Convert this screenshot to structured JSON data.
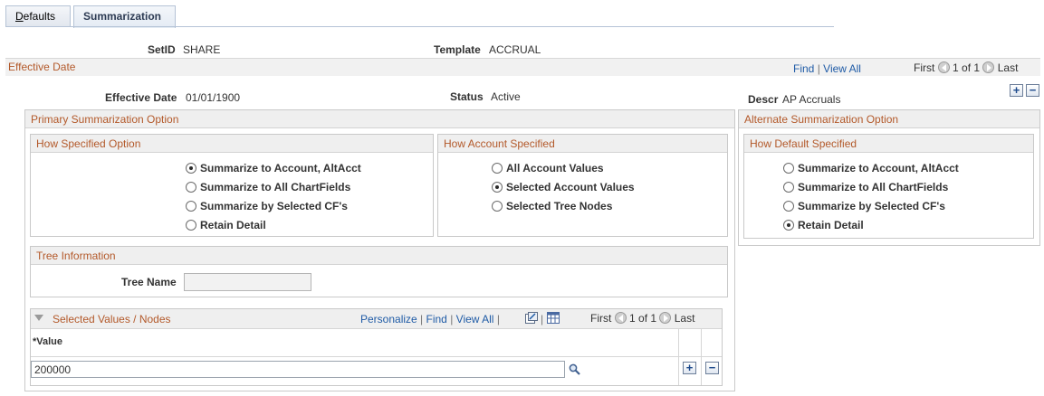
{
  "tabs": [
    {
      "label": "Defaults",
      "underline": "D",
      "rest": "efaults"
    },
    {
      "label": "Summarization"
    }
  ],
  "header": {
    "setid_label": "SetID",
    "setid_value": "SHARE",
    "template_label": "Template",
    "template_value": "ACCRUAL"
  },
  "effective_date": {
    "title": "Effective Date",
    "find": "Find",
    "view_all": "View All",
    "first": "First",
    "pager": "1 of 1",
    "last": "Last",
    "date_label": "Effective Date",
    "date_value": "01/01/1900",
    "status_label": "Status",
    "status_value": "Active",
    "descr_label": "Descr",
    "descr_value": "AP Accruals"
  },
  "primary": {
    "title": "Primary Summarization Option",
    "how_specified": {
      "title": "How Specified Option",
      "options": [
        {
          "label": "Summarize to Account, AltAcct",
          "selected": true
        },
        {
          "label": "Summarize to All ChartFields",
          "selected": false
        },
        {
          "label": "Summarize by Selected CF's",
          "selected": false
        },
        {
          "label": "Retain Detail",
          "selected": false
        }
      ]
    },
    "account_specified": {
      "title": "How Account Specified",
      "options": [
        {
          "label": "All Account Values",
          "selected": false
        },
        {
          "label": "Selected Account Values",
          "selected": true
        },
        {
          "label": "Selected Tree Nodes",
          "selected": false
        }
      ]
    },
    "tree_info": {
      "title": "Tree Information",
      "tree_name_label": "Tree Name",
      "tree_name_value": ""
    },
    "selected_values": {
      "title": "Selected Values / Nodes",
      "personalize": "Personalize",
      "find": "Find",
      "view_all": "View All",
      "first": "First",
      "pager": "1 of 1",
      "last": "Last",
      "column_header": "*Value",
      "rows": [
        {
          "value": "200000"
        }
      ]
    }
  },
  "alternate": {
    "title": "Alternate Summarization Option",
    "how_default": {
      "title": "How Default Specified",
      "options": [
        {
          "label": "Summarize to Account, AltAcct",
          "selected": false
        },
        {
          "label": "Summarize to All ChartFields",
          "selected": false
        },
        {
          "label": "Summarize by Selected CF's",
          "selected": false
        },
        {
          "label": "Retain Detail",
          "selected": true
        }
      ]
    }
  },
  "buttons": {
    "add": "+",
    "remove": "−"
  },
  "icons": {
    "first_arrow": "arrow-left-icon",
    "last_arrow": "arrow-right-icon",
    "lookup": "magnifier-icon",
    "zoom": "new-window-icon",
    "download": "grid-download-icon",
    "collapse": "triangle-down-icon"
  },
  "colors": {
    "section_title": "#b3592a",
    "link": "#1f5ba6"
  }
}
